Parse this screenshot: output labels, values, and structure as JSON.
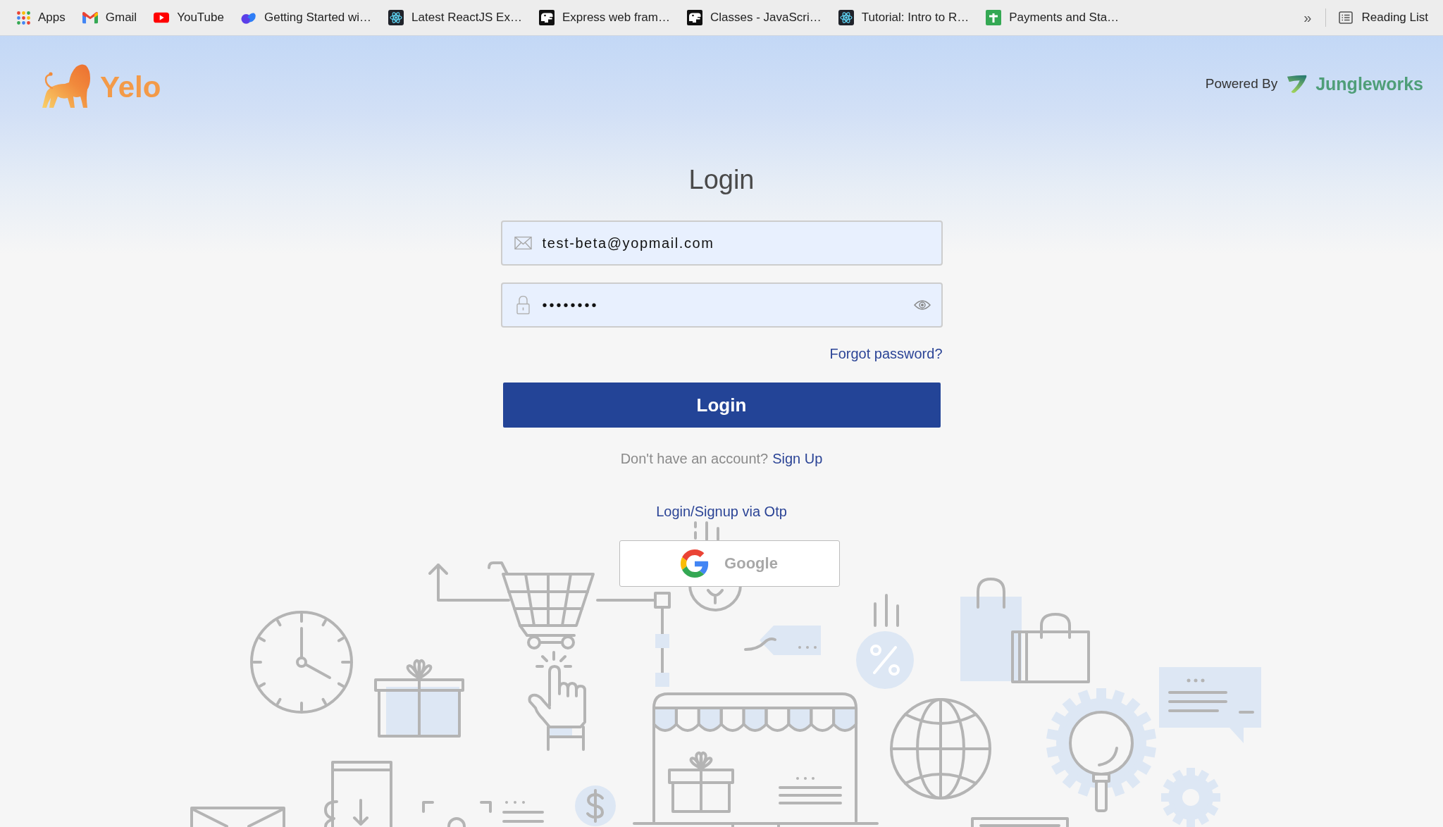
{
  "bookmarks_bar": {
    "items": [
      {
        "kind": "apps",
        "label": "Apps"
      },
      {
        "kind": "gmail",
        "label": "Gmail"
      },
      {
        "kind": "youtube",
        "label": "YouTube"
      },
      {
        "kind": "swirl",
        "label": "Getting Started wi…"
      },
      {
        "kind": "atom",
        "label": "Latest ReactJS Ex…"
      },
      {
        "kind": "dino",
        "label": "Express web fram…"
      },
      {
        "kind": "dino",
        "label": "Classes - JavaScri…"
      },
      {
        "kind": "atom",
        "label": "Tutorial: Intro to R…"
      },
      {
        "kind": "sheet",
        "label": "Payments and Sta…"
      }
    ],
    "overflow": "»",
    "reading_list": "Reading List"
  },
  "header": {
    "brand": "Yelo",
    "powered_by": "Powered By",
    "partner": "Jungleworks"
  },
  "login_form": {
    "title": "Login",
    "email": {
      "value": "test-beta@yopmail.com"
    },
    "password": {
      "value": "••••••••"
    },
    "forgot_password": "Forgot password?",
    "submit": "Login",
    "signup_prompt": "Don't have an account?",
    "signup_link": "Sign Up",
    "otp_link": "Login/Signup via Otp",
    "google_button": "Google"
  }
}
